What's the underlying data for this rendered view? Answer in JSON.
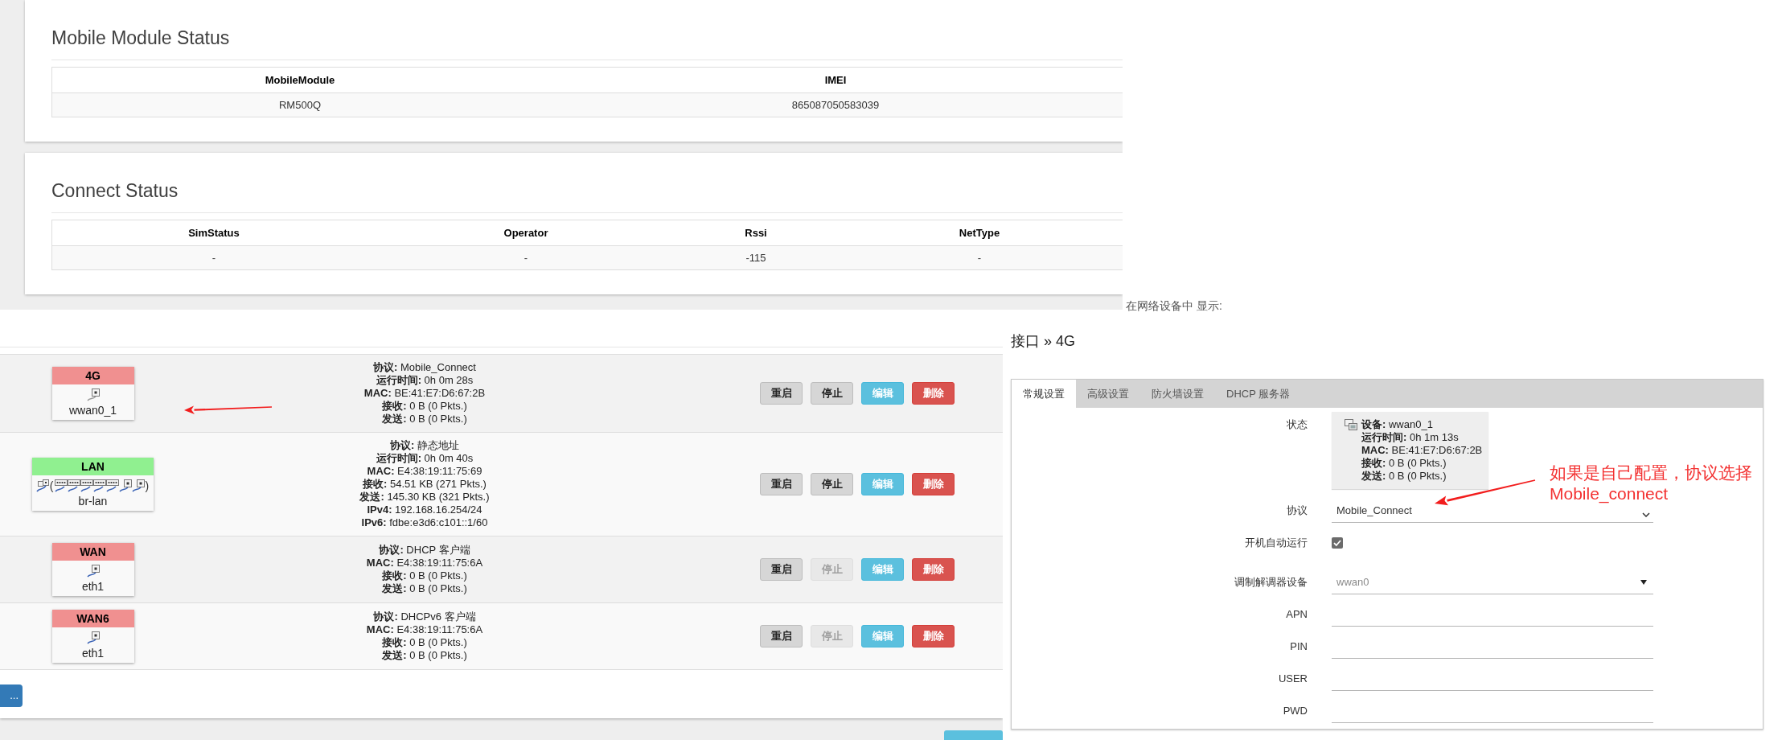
{
  "mobile_module_status": {
    "title": "Mobile Module Status",
    "columns": [
      "MobileModule",
      "IMEI"
    ],
    "rows": [
      [
        "RM500Q",
        "865087050583039"
      ]
    ]
  },
  "connect_status": {
    "title": "Connect Status",
    "columns": [
      "SimStatus",
      "Operator",
      "Rssi",
      "NetType"
    ],
    "rows": [
      [
        "-",
        "-",
        "-115",
        "-"
      ]
    ]
  },
  "interfaces": {
    "rows": [
      {
        "name": "4G",
        "color": "#f09090",
        "icons": [
          {
            "kind": "unlinked"
          }
        ],
        "device": "wwan0_1",
        "status": [
          "**协议:** Mobile_Connect",
          "**运行时间:** 0h 0m 28s",
          "**MAC:** BE:41:E7:D6:67:2B",
          "**接收:** 0 B (0 Pkts.)",
          "**发送:** 0 B (0 Pkts.)"
        ],
        "buttons": [
          {
            "label": "重启",
            "kind": "restart",
            "disabled": false
          },
          {
            "label": "停止",
            "kind": "stop",
            "disabled": false
          },
          {
            "label": "编辑",
            "kind": "edit",
            "disabled": false
          },
          {
            "label": "删除",
            "kind": "delete",
            "disabled": false
          }
        ]
      },
      {
        "name": "LAN",
        "color": "#90f090",
        "icons": [
          {
            "kind": "bridge"
          },
          {
            "kind": "text",
            "text": "("
          },
          {
            "kind": "switch"
          },
          {
            "kind": "switch"
          },
          {
            "kind": "switch"
          },
          {
            "kind": "switch"
          },
          {
            "kind": "switch"
          },
          {
            "kind": "port"
          },
          {
            "kind": "port"
          },
          {
            "kind": "text",
            "text": ")"
          }
        ],
        "device": "br-lan",
        "status": [
          "**协议:** 静态地址",
          "**运行时间:** 0h 0m 40s",
          "**MAC:** E4:38:19:11:75:69",
          "**接收:** 54.51 KB (271 Pkts.)",
          "**发送:** 145.30 KB (321 Pkts.)",
          "**IPv4:** 192.168.16.254/24",
          "**IPv6:** fdbe:e3d6:c101::1/60"
        ],
        "buttons": [
          {
            "label": "重启",
            "kind": "restart",
            "disabled": false
          },
          {
            "label": "停止",
            "kind": "stop",
            "disabled": false
          },
          {
            "label": "编辑",
            "kind": "edit",
            "disabled": false
          },
          {
            "label": "删除",
            "kind": "delete",
            "disabled": false
          }
        ]
      },
      {
        "name": "WAN",
        "color": "#f09090",
        "icons": [
          {
            "kind": "port"
          }
        ],
        "device": "eth1",
        "status": [
          "**协议:** DHCP 客户端",
          "**MAC:** E4:38:19:11:75:6A",
          "**接收:** 0 B (0 Pkts.)",
          "**发送:** 0 B (0 Pkts.)"
        ],
        "buttons": [
          {
            "label": "重启",
            "kind": "restart",
            "disabled": false
          },
          {
            "label": "停止",
            "kind": "stop",
            "disabled": true
          },
          {
            "label": "编辑",
            "kind": "edit",
            "disabled": false
          },
          {
            "label": "删除",
            "kind": "delete",
            "disabled": false
          }
        ]
      },
      {
        "name": "WAN6",
        "color": "#f09090",
        "icons": [
          {
            "kind": "port"
          }
        ],
        "device": "eth1",
        "status": [
          "**协议:** DHCPv6 客户端",
          "**MAC:** E4:38:19:11:75:6A",
          "**接收:** 0 B (0 Pkts.)",
          "**发送:** 0 B (0 Pkts.)"
        ],
        "buttons": [
          {
            "label": "重启",
            "kind": "restart",
            "disabled": false
          },
          {
            "label": "停止",
            "kind": "stop",
            "disabled": true
          },
          {
            "label": "编辑",
            "kind": "edit",
            "disabled": false
          },
          {
            "label": "删除",
            "kind": "delete",
            "disabled": false
          }
        ]
      }
    ],
    "add_button": {
      "label": "..."
    }
  },
  "network_device_note": "在网络设备中 显示:",
  "interface_editor": {
    "title": "接口 » 4G",
    "tabs": [
      {
        "label": "常规设置",
        "selected": true
      },
      {
        "label": "高级设置",
        "selected": false
      },
      {
        "label": "防火墙设置",
        "selected": false
      },
      {
        "label": "DHCP 服务器",
        "selected": false
      }
    ],
    "fields": [
      {
        "kind": "status",
        "label": "状态",
        "lines": [
          "**设备:** wwan0_1",
          "**运行时间:** 0h 1m 13s",
          "**MAC:** BE:41:E7:D6:67:2B",
          "**接收:** 0 B (0 Pkts.)",
          "**发送:** 0 B (0 Pkts.)"
        ]
      },
      {
        "kind": "select",
        "label": "协议",
        "value": "Mobile_Connect"
      },
      {
        "kind": "checkbox",
        "label": "开机自动运行",
        "checked": true
      },
      {
        "kind": "dropdown",
        "label": "调制解调器设备",
        "value": "wwan0"
      },
      {
        "kind": "text",
        "label": "APN"
      },
      {
        "kind": "text",
        "label": "PIN"
      },
      {
        "kind": "text",
        "label": "USER"
      },
      {
        "kind": "text",
        "label": "PWD"
      }
    ]
  },
  "annotation": {
    "lines": [
      "如果是自己配置，协议选择",
      "Mobile_connect"
    ]
  }
}
